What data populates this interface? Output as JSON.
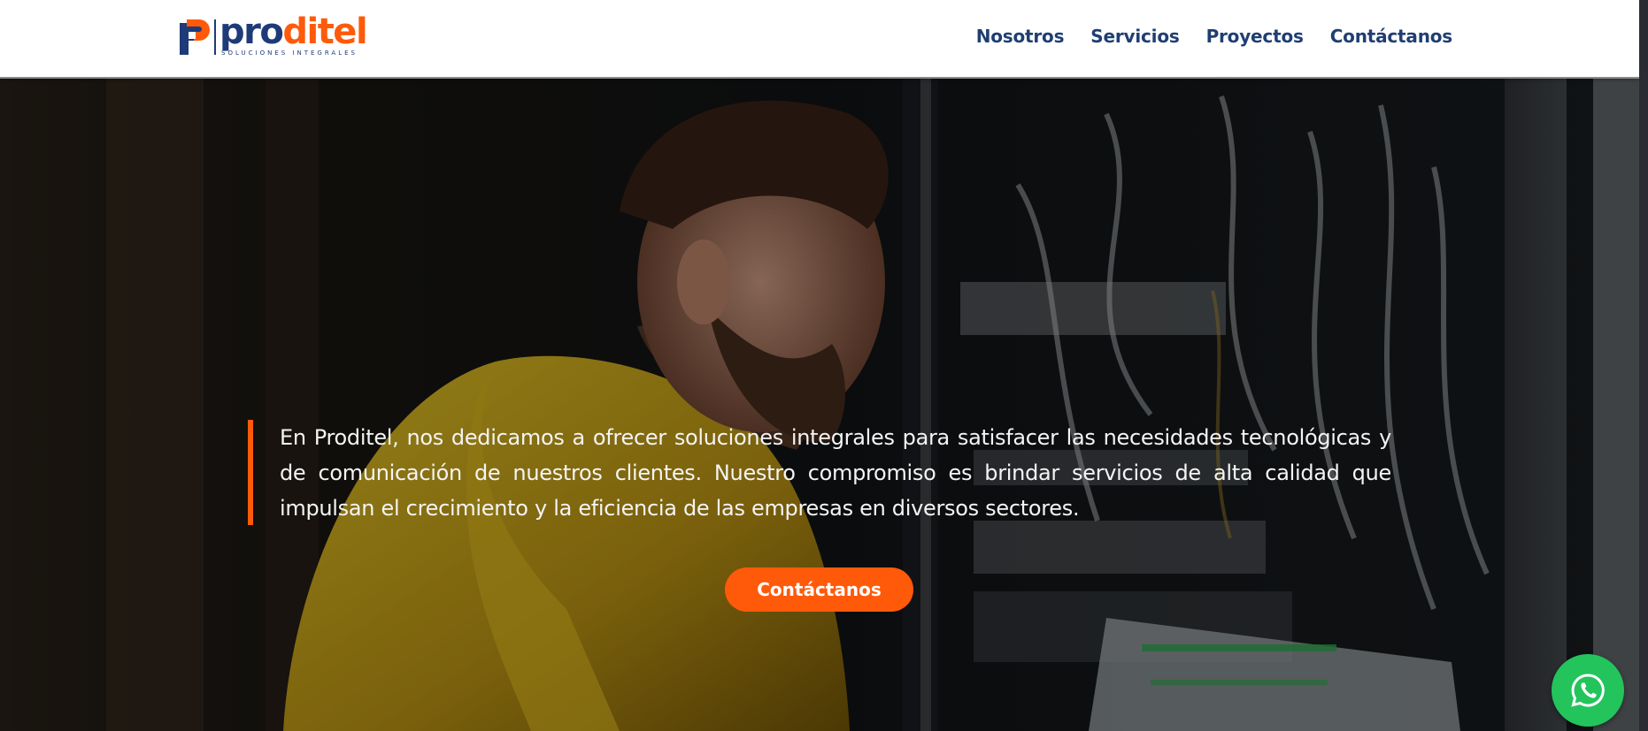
{
  "header": {
    "logo": {
      "word_part1": "pro",
      "word_part2": "ditel",
      "tagline": "SOLUCIONES INTEGRALES"
    },
    "nav": [
      {
        "label": "Nosotros"
      },
      {
        "label": "Servicios"
      },
      {
        "label": "Proyectos"
      },
      {
        "label": "Contáctanos"
      }
    ]
  },
  "hero": {
    "background_image": "technician-in-yellow-jacket-at-server-rack",
    "text": "En Proditel, nos dedicamos a ofrecer soluciones integrales para satisfacer las necesidades tecnológicas y de comunicación de nuestros clientes. Nuestro compromiso es brindar servicios de alta calidad que impulsan el crecimiento y la eficiencia de las empresas en diversos sectores.",
    "cta_label": "Contáctanos"
  },
  "floating": {
    "whatsapp_icon": "whatsapp-icon"
  },
  "colors": {
    "brand_blue": "#1e3a78",
    "brand_orange": "#ff5a0a",
    "whatsapp_green": "#23c45c"
  }
}
